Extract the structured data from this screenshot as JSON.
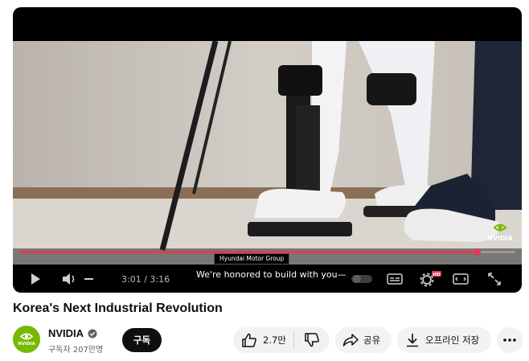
{
  "video": {
    "current_time": "3:01",
    "time_separator": "/",
    "duration": "3:16",
    "progress_fraction": 0.923,
    "caption_speaker": "Hyundai Motor Group",
    "caption_text": "We're honored to build with you—",
    "watermark_text": "NVIDIA",
    "settings_badge": "HD"
  },
  "title": "Korea's Next Industrial Revolution",
  "channel": {
    "name": "NVIDIA",
    "subscribers": "구독자 207만명",
    "avatar_text": "NVIDIA"
  },
  "actions": {
    "subscribe_label": "구독",
    "like_count": "2.7만",
    "share_label": "공유",
    "offline_label": "오프라인 저장"
  },
  "icons": [
    "play-icon",
    "volume-icon",
    "autoplay-toggle-icon",
    "subtitles-icon",
    "settings-icon",
    "miniplayer-icon",
    "fullscreen-icon",
    "verified-icon",
    "like-icon",
    "dislike-icon",
    "share-icon",
    "download-icon",
    "more-icon"
  ],
  "colors": {
    "progress": "#e23a57",
    "brand": "#76b900",
    "subscribe_bg": "#0f0f0f"
  }
}
